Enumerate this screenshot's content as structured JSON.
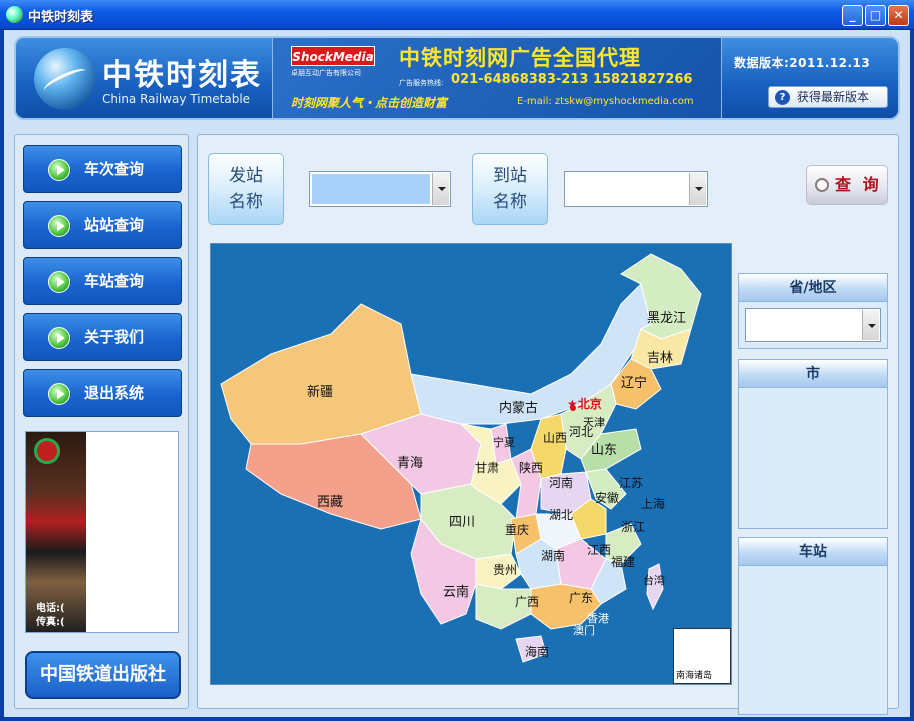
{
  "window": {
    "title": "中铁时刻表",
    "minimize": "_",
    "maximize": "□",
    "close": "✕"
  },
  "header": {
    "brand_cn": "中铁时刻表",
    "brand_en": "China Railway Timetable",
    "ad": {
      "logo": "ShockMedia",
      "logo_sub": "卓朋互动广告有限公司",
      "title": "中铁时刻网广告全国代理",
      "hotline_label": "广告服务热线:",
      "phone": "021-64868383-213   15821827266",
      "slogan": "时刻网聚人气・点击创造财富",
      "email": "E-mail: ztskw@myshockmedia.com"
    },
    "version": "数据版本:2011.12.13",
    "update_button": "获得最新版本"
  },
  "nav": {
    "items": [
      {
        "label": "车次查询"
      },
      {
        "label": "站站查询"
      },
      {
        "label": "车站查询"
      },
      {
        "label": "关于我们"
      },
      {
        "label": "退出系统"
      }
    ],
    "promo_contact": [
      "电话:(",
      "传真:("
    ],
    "publisher": "中国铁道出版社"
  },
  "search": {
    "from_label_1": "发站",
    "from_label_2": "名称",
    "to_label_1": "到站",
    "to_label_2": "名称",
    "from_value": "",
    "to_value": "",
    "query_button": "查 询"
  },
  "map": {
    "capital": "★北京",
    "provinces": [
      "新疆",
      "西藏",
      "青海",
      "内蒙古",
      "黑龙江",
      "吉林",
      "辽宁",
      "河北",
      "天津",
      "山西",
      "山东",
      "宁夏",
      "甘肃",
      "陕西",
      "河南",
      "江苏",
      "上海",
      "安徽",
      "四川",
      "重庆",
      "湖北",
      "浙江",
      "湖南",
      "江西",
      "福建",
      "贵州",
      "云南",
      "广西",
      "广东",
      "台湾",
      "香港",
      "澳门",
      "海南"
    ],
    "inset_label": "南海诸岛"
  },
  "filters": {
    "province_label": "省/地区",
    "province_value": "",
    "city_label": "市",
    "station_label": "车站"
  },
  "colors": {
    "accent": "#1964d0",
    "map_sea": "#1b6fb3"
  }
}
